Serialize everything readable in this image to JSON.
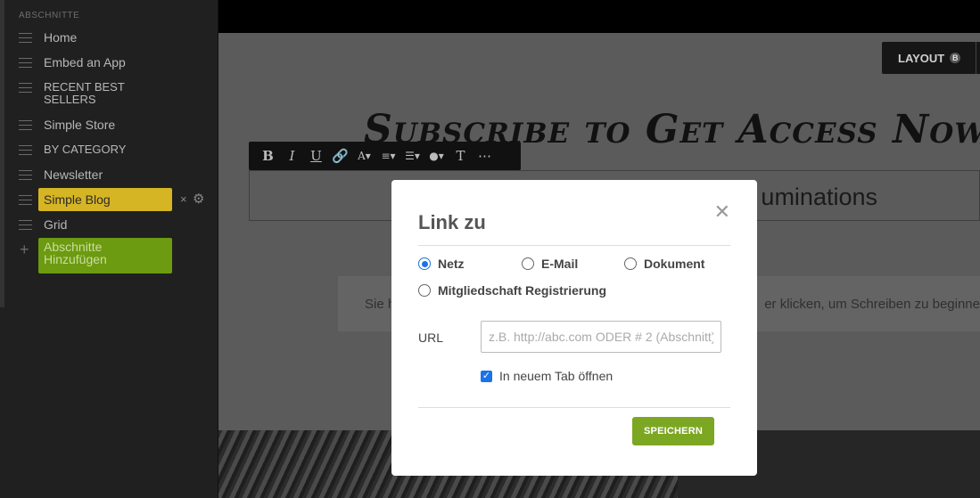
{
  "sidebar": {
    "heading": "ABSCHNITTE",
    "items": [
      {
        "label": "Home"
      },
      {
        "label": "Embed an App"
      },
      {
        "label": "RECENT BEST SELLERS"
      },
      {
        "label": "Simple Store"
      },
      {
        "label": "BY CATEGORY"
      },
      {
        "label": "Newsletter"
      },
      {
        "label": "Simple Blog",
        "selected": true
      },
      {
        "label": "Grid"
      }
    ],
    "selected_actions": {
      "close_icon": "×",
      "settings_icon": "gear-icon"
    },
    "add_section_label": "Abschnitte Hinzufügen"
  },
  "canvas": {
    "layout_button": "LAYOUT",
    "layout_badge": "B",
    "headline": "Subscribe to Get Access Now",
    "text_box_content": "uminations",
    "hint_left": "Sie h",
    "hint_right": "er klicken, um Schreiben zu beginne"
  },
  "toolbar": {
    "buttons": [
      "bold-icon",
      "italic-icon",
      "underline-icon",
      "link-icon",
      "font-size-icon",
      "align-icon",
      "list-icon",
      "color-icon",
      "text-style-icon",
      "more-icon"
    ]
  },
  "modal": {
    "title": "Link zu",
    "radios": [
      {
        "label": "Netz",
        "checked": true
      },
      {
        "label": "E-Mail",
        "checked": false
      },
      {
        "label": "Dokument",
        "checked": false
      },
      {
        "label": "Mitgliedschaft Registrierung",
        "checked": false
      }
    ],
    "url_label": "URL",
    "url_placeholder": "z.B. http://abc.com ODER # 2 (Abschnitt)",
    "url_value": "",
    "new_tab_label": "In neuem Tab öffnen",
    "new_tab_checked": true,
    "save_label": "SPEICHERN"
  },
  "colors": {
    "accent_green": "#7ca722",
    "selected_yellow": "#d6b524",
    "radio_blue": "#1a73e8"
  }
}
